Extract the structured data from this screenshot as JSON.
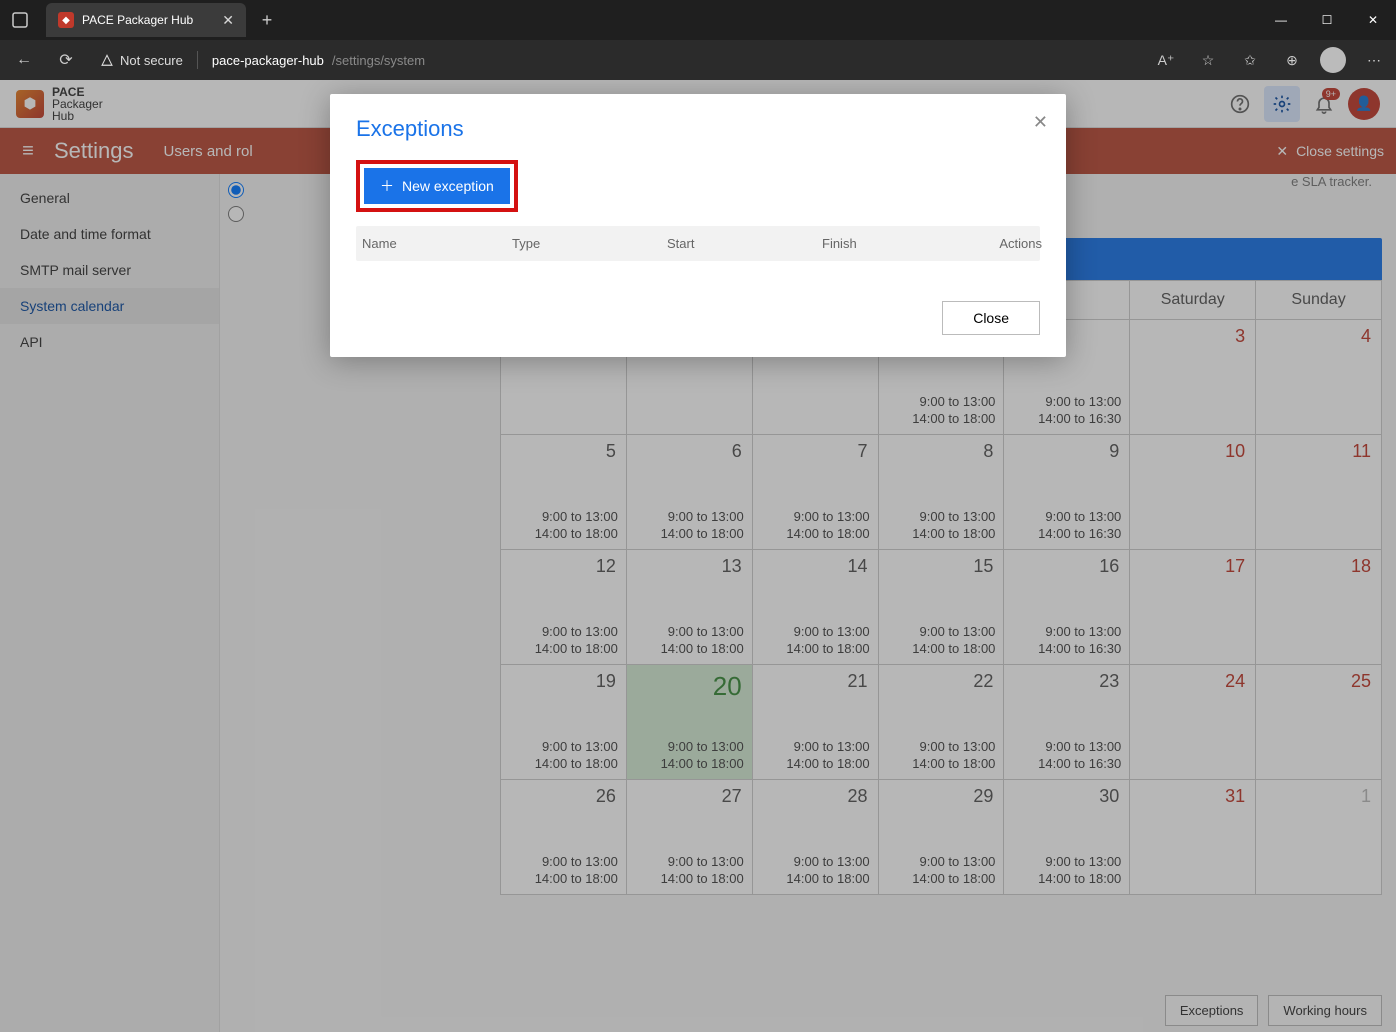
{
  "browser": {
    "tab_title": "PACE Packager Hub",
    "not_secure": "Not secure",
    "url_host": "pace-packager-hub",
    "url_path": "/settings/system"
  },
  "app_header": {
    "brand_line1": "PACE",
    "brand_line2": "Packager",
    "brand_line3": "Hub",
    "bell_badge": "9+"
  },
  "settings_bar": {
    "title": "Settings",
    "subtitle": "Users and rol",
    "close": "Close settings"
  },
  "sidebar": {
    "items": [
      "General",
      "Date and time format",
      "SMTP mail server",
      "System calendar",
      "API"
    ],
    "active_index": 3
  },
  "hint_fragment": "e SLA tracker.",
  "calendar": {
    "day_labels": [
      "",
      "",
      "",
      "",
      "",
      "Saturday",
      "Sunday"
    ],
    "footer": {
      "exceptions": "Exceptions",
      "working": "Working hours"
    },
    "weeks": [
      [
        {
          "n": "",
          "t1": "",
          "t2": ""
        },
        {
          "n": "",
          "t1": "",
          "t2": ""
        },
        {
          "n": "",
          "t1": "",
          "t2": ""
        },
        {
          "n": "",
          "t1": "9:00 to 13:00",
          "t2": "14:00 to 18:00"
        },
        {
          "n": "",
          "t1": "9:00 to 13:00",
          "t2": "14:00 to 16:30"
        },
        {
          "n": "3",
          "t1": "",
          "t2": "",
          "weekend": true
        },
        {
          "n": "4",
          "t1": "",
          "t2": "",
          "weekend": true
        }
      ],
      [
        {
          "n": "5",
          "t1": "9:00 to 13:00",
          "t2": "14:00 to 18:00"
        },
        {
          "n": "6",
          "t1": "9:00 to 13:00",
          "t2": "14:00 to 18:00"
        },
        {
          "n": "7",
          "t1": "9:00 to 13:00",
          "t2": "14:00 to 18:00"
        },
        {
          "n": "8",
          "t1": "9:00 to 13:00",
          "t2": "14:00 to 18:00"
        },
        {
          "n": "9",
          "t1": "9:00 to 13:00",
          "t2": "14:00 to 16:30"
        },
        {
          "n": "10",
          "t1": "",
          "t2": "",
          "weekend": true
        },
        {
          "n": "11",
          "t1": "",
          "t2": "",
          "weekend": true
        }
      ],
      [
        {
          "n": "12",
          "t1": "9:00 to 13:00",
          "t2": "14:00 to 18:00"
        },
        {
          "n": "13",
          "t1": "9:00 to 13:00",
          "t2": "14:00 to 18:00"
        },
        {
          "n": "14",
          "t1": "9:00 to 13:00",
          "t2": "14:00 to 18:00"
        },
        {
          "n": "15",
          "t1": "9:00 to 13:00",
          "t2": "14:00 to 18:00"
        },
        {
          "n": "16",
          "t1": "9:00 to 13:00",
          "t2": "14:00 to 16:30"
        },
        {
          "n": "17",
          "t1": "",
          "t2": "",
          "weekend": true
        },
        {
          "n": "18",
          "t1": "",
          "t2": "",
          "weekend": true
        }
      ],
      [
        {
          "n": "19",
          "t1": "9:00 to 13:00",
          "t2": "14:00 to 18:00"
        },
        {
          "n": "20",
          "t1": "9:00 to 13:00",
          "t2": "14:00 to 18:00",
          "today": true
        },
        {
          "n": "21",
          "t1": "9:00 to 13:00",
          "t2": "14:00 to 18:00"
        },
        {
          "n": "22",
          "t1": "9:00 to 13:00",
          "t2": "14:00 to 18:00"
        },
        {
          "n": "23",
          "t1": "9:00 to 13:00",
          "t2": "14:00 to 16:30"
        },
        {
          "n": "24",
          "t1": "",
          "t2": "",
          "weekend": true
        },
        {
          "n": "25",
          "t1": "",
          "t2": "",
          "weekend": true
        }
      ],
      [
        {
          "n": "26",
          "t1": "9:00 to 13:00",
          "t2": "14:00 to 18:00"
        },
        {
          "n": "27",
          "t1": "9:00 to 13:00",
          "t2": "14:00 to 18:00"
        },
        {
          "n": "28",
          "t1": "9:00 to 13:00",
          "t2": "14:00 to 18:00"
        },
        {
          "n": "29",
          "t1": "9:00 to 13:00",
          "t2": "14:00 to 18:00"
        },
        {
          "n": "30",
          "t1": "9:00 to 13:00",
          "t2": "14:00 to 18:00"
        },
        {
          "n": "31",
          "t1": "",
          "t2": "",
          "weekend": true
        },
        {
          "n": "1",
          "t1": "",
          "t2": "",
          "weekend": true,
          "other": true
        }
      ]
    ]
  },
  "modal": {
    "title": "Exceptions",
    "new_button": "New exception",
    "columns": {
      "name": "Name",
      "type": "Type",
      "start": "Start",
      "finish": "Finish",
      "actions": "Actions"
    },
    "close_button": "Close"
  }
}
